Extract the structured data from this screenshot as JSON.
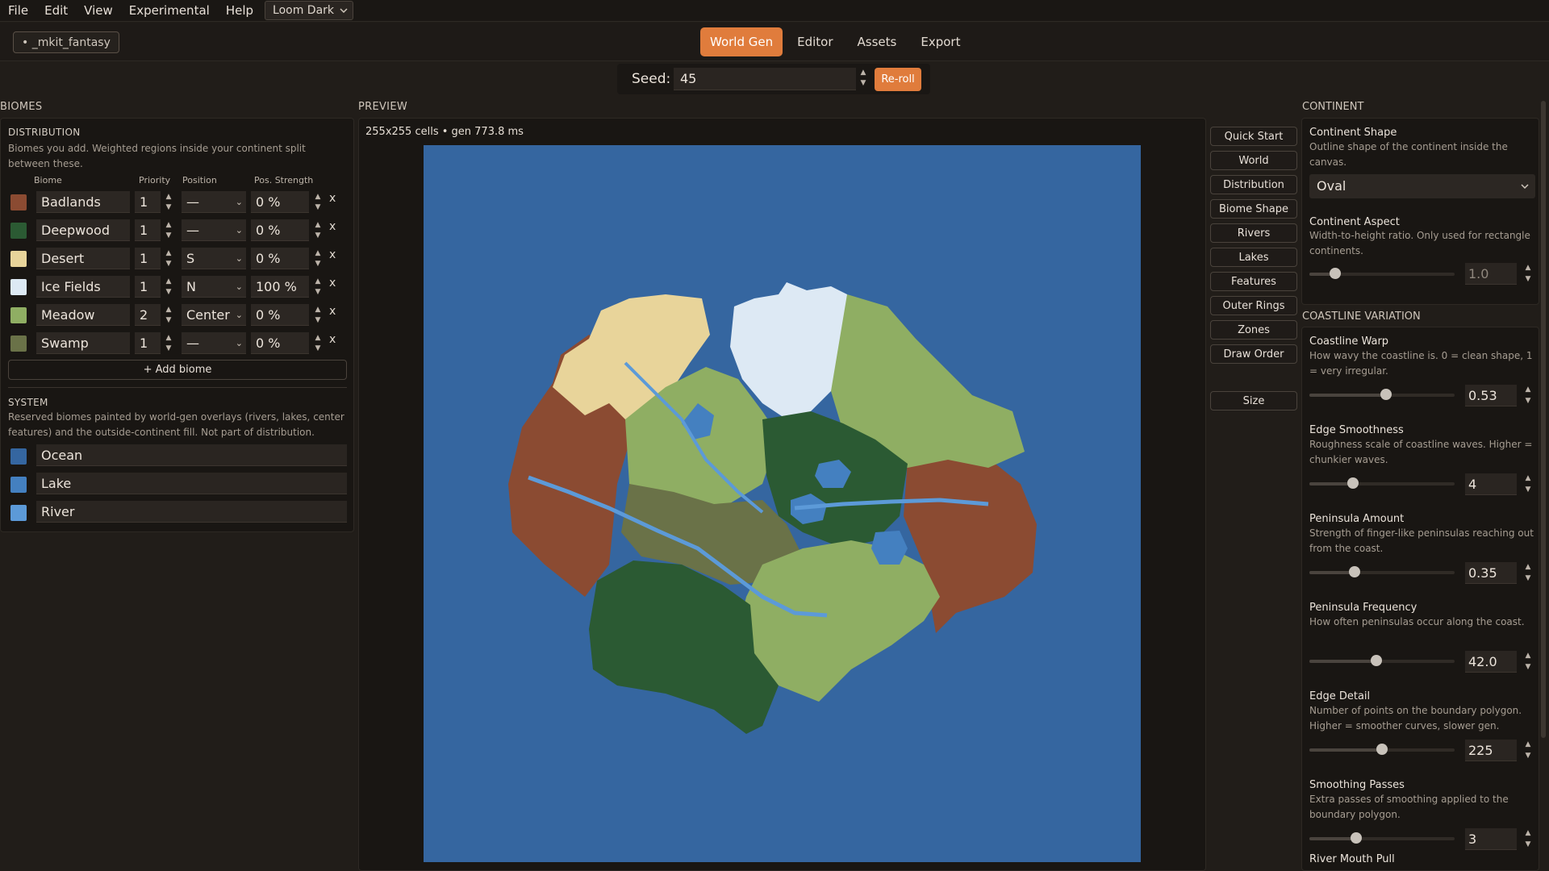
{
  "menubar": {
    "items": [
      "File",
      "Edit",
      "View",
      "Experimental",
      "Help"
    ],
    "theme": "Loom Dark"
  },
  "project": {
    "name": "• _mkit_fantasy"
  },
  "tabs": [
    {
      "label": "World Gen",
      "active": true
    },
    {
      "label": "Editor",
      "active": false
    },
    {
      "label": "Assets",
      "active": false
    },
    {
      "label": "Export",
      "active": false
    }
  ],
  "seed": {
    "label": "Seed:",
    "value": "45",
    "reroll_label": "Re-roll"
  },
  "biomes_panel": {
    "title": "BIOMES",
    "distribution_title": "DISTRIBUTION",
    "distribution_desc": "Biomes you add. Weighted regions inside your continent split between these.",
    "columns": [
      "Biome",
      "Priority",
      "Position",
      "Pos. Strength"
    ],
    "rows": [
      {
        "name": "Badlands",
        "color": "#8b4b32",
        "priority": "1",
        "position": "—",
        "strength": "0 %"
      },
      {
        "name": "Deepwood",
        "color": "#2b5a33",
        "priority": "1",
        "position": "—",
        "strength": "0 %"
      },
      {
        "name": "Desert",
        "color": "#e8d49a",
        "priority": "1",
        "position": "S",
        "strength": "0 %"
      },
      {
        "name": "Ice Fields",
        "color": "#dde9f4",
        "priority": "1",
        "position": "N",
        "strength": "100 %"
      },
      {
        "name": "Meadow",
        "color": "#8fae63",
        "priority": "2",
        "position": "Center",
        "strength": "0 %"
      },
      {
        "name": "Swamp",
        "color": "#6a7248",
        "priority": "1",
        "position": "—",
        "strength": "0 %"
      }
    ],
    "add_label": "+ Add biome",
    "system_title": "SYSTEM",
    "system_desc": "Reserved biomes painted by world-gen overlays (rivers, lakes, center features) and the outside-continent fill. Not part of distribution.",
    "system_rows": [
      {
        "name": "Ocean",
        "color": "#3566a0"
      },
      {
        "name": "Lake",
        "color": "#4480c0"
      },
      {
        "name": "River",
        "color": "#5c9ad8"
      }
    ]
  },
  "preview": {
    "title": "PREVIEW",
    "info": "255x255 cells • gen 773.8 ms"
  },
  "nav_buttons": [
    "Quick Start",
    "World",
    "Distribution",
    "Biome Shape",
    "Rivers",
    "Lakes",
    "Features",
    "Outer Rings",
    "Zones",
    "Draw Order",
    "Size"
  ],
  "continent": {
    "title": "CONTINENT",
    "shape_title": "Continent Shape",
    "shape_desc": "Outline shape of the continent inside the canvas.",
    "shape_value": "Oval",
    "aspect_title": "Continent Aspect",
    "aspect_desc": "Width-to-height ratio. Only used for rectangle continents.",
    "aspect_value": "1.0",
    "aspect_level": 0.18
  },
  "coastline": {
    "title": "COASTLINE VARIATION",
    "props": [
      {
        "title": "Coastline Warp",
        "desc": "How wavy the coastline is. 0 = clean shape, 1 = very irregular.",
        "value": "0.53",
        "level": 0.53
      },
      {
        "title": "Edge Smoothness",
        "desc": "Roughness scale of coastline waves. Higher = chunkier waves.",
        "value": "4",
        "level": 0.3
      },
      {
        "title": "Peninsula Amount",
        "desc": "Strength of finger-like peninsulas reaching out from the coast.",
        "value": "0.35",
        "level": 0.31
      },
      {
        "title": "Peninsula Frequency",
        "desc": "How often peninsulas occur along the coast.",
        "value": "42.0",
        "level": 0.46
      },
      {
        "title": "Edge Detail",
        "desc": "Number of points on the boundary polygon. Higher = smoother curves, slower gen.",
        "value": "225",
        "level": 0.5
      },
      {
        "title": "Smoothing Passes",
        "desc": "Extra passes of smoothing applied to the boundary polygon.",
        "value": "3",
        "level": 0.32
      }
    ],
    "next_title": "River Mouth Pull"
  }
}
